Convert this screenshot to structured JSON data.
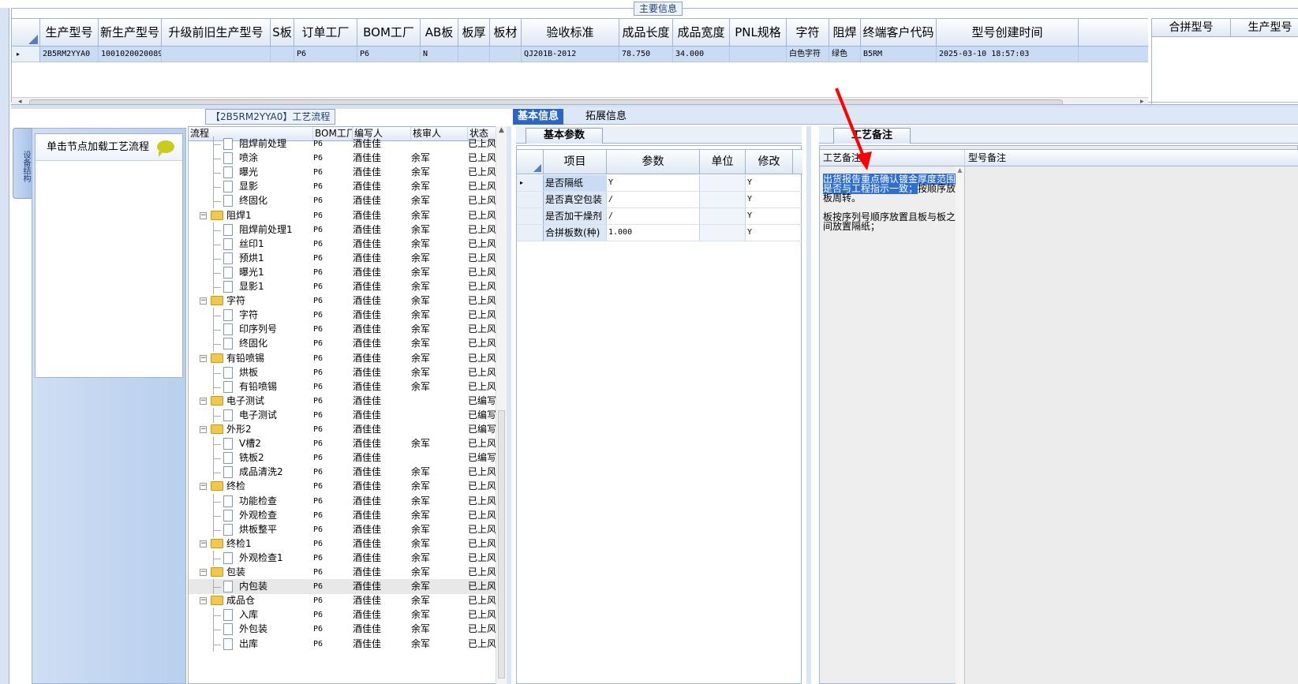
{
  "main_panel": {
    "title": "主要信息",
    "columns": [
      "生产型号",
      "新生产型号",
      "升级前旧生产型号",
      "S板",
      "订单工厂",
      "BOM工厂",
      "AB板",
      "板厚",
      "板材",
      "验收标准",
      "成品长度",
      "成品宽度",
      "PNL规格",
      "字符",
      "阻焊",
      "终端客户代码",
      "型号创建时间"
    ],
    "row": [
      "2B5RM2YYA0",
      "10010200200899",
      "",
      "",
      "P6",
      "P6",
      "N",
      "",
      "",
      "QJ201B-2012",
      "78.750",
      "34.000",
      "",
      "白色字符",
      "绿色",
      "B5RM",
      "2025-03-10 18:57:03"
    ],
    "row_marker": "▸",
    "merge_columns": [
      "合拼型号",
      "生产型号"
    ]
  },
  "sidebar": {
    "tab_label": "设备结构",
    "load_label": "单击节点加载工艺流程"
  },
  "flow": {
    "title": "【2B5RM2YYA0】工艺流程",
    "columns": [
      "流程",
      "BOM工厂",
      "编写人",
      "核审人",
      "状态"
    ],
    "rows": [
      {
        "label": "阻焊前处理",
        "level": 2,
        "folder": false,
        "bom": "P6",
        "writer": "酒佳佳",
        "reviewer": "",
        "status": "已上风"
      },
      {
        "label": "喷涂",
        "level": 2,
        "folder": false,
        "bom": "P6",
        "writer": "酒佳佳",
        "reviewer": "余军",
        "status": "已上风"
      },
      {
        "label": "曝光",
        "level": 2,
        "folder": false,
        "bom": "P6",
        "writer": "酒佳佳",
        "reviewer": "余军",
        "status": "已上风"
      },
      {
        "label": "显影",
        "level": 2,
        "folder": false,
        "bom": "P6",
        "writer": "酒佳佳",
        "reviewer": "余军",
        "status": "已上风"
      },
      {
        "label": "终固化",
        "level": 2,
        "folder": false,
        "bom": "P6",
        "writer": "酒佳佳",
        "reviewer": "余军",
        "status": "已上风"
      },
      {
        "label": "阻焊1",
        "level": 1,
        "folder": true,
        "bom": "P6",
        "writer": "酒佳佳",
        "reviewer": "余军",
        "status": "已上风"
      },
      {
        "label": "阻焊前处理1",
        "level": 2,
        "folder": false,
        "bom": "P6",
        "writer": "酒佳佳",
        "reviewer": "余军",
        "status": "已上风"
      },
      {
        "label": "丝印1",
        "level": 2,
        "folder": false,
        "bom": "P6",
        "writer": "酒佳佳",
        "reviewer": "余军",
        "status": "已上风"
      },
      {
        "label": "预烘1",
        "level": 2,
        "folder": false,
        "bom": "P6",
        "writer": "酒佳佳",
        "reviewer": "余军",
        "status": "已上风"
      },
      {
        "label": "曝光1",
        "level": 2,
        "folder": false,
        "bom": "P6",
        "writer": "酒佳佳",
        "reviewer": "余军",
        "status": "已上风"
      },
      {
        "label": "显影1",
        "level": 2,
        "folder": false,
        "bom": "P6",
        "writer": "酒佳佳",
        "reviewer": "余军",
        "status": "已上风"
      },
      {
        "label": "字符",
        "level": 1,
        "folder": true,
        "bom": "P6",
        "writer": "酒佳佳",
        "reviewer": "余军",
        "status": "已上风"
      },
      {
        "label": "字符",
        "level": 2,
        "folder": false,
        "bom": "P6",
        "writer": "酒佳佳",
        "reviewer": "余军",
        "status": "已上风"
      },
      {
        "label": "印序列号",
        "level": 2,
        "folder": false,
        "bom": "P6",
        "writer": "酒佳佳",
        "reviewer": "余军",
        "status": "已上风"
      },
      {
        "label": "终固化",
        "level": 2,
        "folder": false,
        "bom": "P6",
        "writer": "酒佳佳",
        "reviewer": "余军",
        "status": "已上风"
      },
      {
        "label": "有铅喷锡",
        "level": 1,
        "folder": true,
        "bom": "P6",
        "writer": "酒佳佳",
        "reviewer": "余军",
        "status": "已上风"
      },
      {
        "label": "烘板",
        "level": 2,
        "folder": false,
        "bom": "P6",
        "writer": "酒佳佳",
        "reviewer": "余军",
        "status": "已上风"
      },
      {
        "label": "有铅喷锡",
        "level": 2,
        "folder": false,
        "bom": "P6",
        "writer": "酒佳佳",
        "reviewer": "余军",
        "status": "已上风"
      },
      {
        "label": "电子测试",
        "level": 1,
        "folder": true,
        "bom": "P6",
        "writer": "酒佳佳",
        "reviewer": "",
        "status": "已编写"
      },
      {
        "label": "电子测试",
        "level": 2,
        "folder": false,
        "bom": "P6",
        "writer": "酒佳佳",
        "reviewer": "",
        "status": "已编写"
      },
      {
        "label": "外形2",
        "level": 1,
        "folder": true,
        "bom": "P6",
        "writer": "酒佳佳",
        "reviewer": "",
        "status": "已编写"
      },
      {
        "label": "V槽2",
        "level": 2,
        "folder": false,
        "bom": "P6",
        "writer": "酒佳佳",
        "reviewer": "余军",
        "status": "已上风"
      },
      {
        "label": "铣板2",
        "level": 2,
        "folder": false,
        "bom": "P6",
        "writer": "酒佳佳",
        "reviewer": "",
        "status": "已编写"
      },
      {
        "label": "成品清洗2",
        "level": 2,
        "folder": false,
        "bom": "P6",
        "writer": "酒佳佳",
        "reviewer": "余军",
        "status": "已上风"
      },
      {
        "label": "终检",
        "level": 1,
        "folder": true,
        "bom": "P6",
        "writer": "酒佳佳",
        "reviewer": "余军",
        "status": "已上风"
      },
      {
        "label": "功能检查",
        "level": 2,
        "folder": false,
        "bom": "P6",
        "writer": "酒佳佳",
        "reviewer": "余军",
        "status": "已上风"
      },
      {
        "label": "外观检查",
        "level": 2,
        "folder": false,
        "bom": "P6",
        "writer": "酒佳佳",
        "reviewer": "余军",
        "status": "已上风"
      },
      {
        "label": "烘板整平",
        "level": 2,
        "folder": false,
        "bom": "P6",
        "writer": "酒佳佳",
        "reviewer": "余军",
        "status": "已上风"
      },
      {
        "label": "终检1",
        "level": 1,
        "folder": true,
        "bom": "P6",
        "writer": "酒佳佳",
        "reviewer": "余军",
        "status": "已上风"
      },
      {
        "label": "外观检查1",
        "level": 2,
        "folder": false,
        "bom": "P6",
        "writer": "酒佳佳",
        "reviewer": "余军",
        "status": "已上风"
      },
      {
        "label": "包装",
        "level": 1,
        "folder": true,
        "bom": "P6",
        "writer": "酒佳佳",
        "reviewer": "余军",
        "status": "已上风"
      },
      {
        "label": "内包装",
        "level": 2,
        "folder": false,
        "bom": "P6",
        "writer": "酒佳佳",
        "reviewer": "余军",
        "status": "已上风",
        "selected": true
      },
      {
        "label": "成品仓",
        "level": 1,
        "folder": true,
        "bom": "P6",
        "writer": "酒佳佳",
        "reviewer": "余军",
        "status": "已上风"
      },
      {
        "label": "入库",
        "level": 2,
        "folder": false,
        "bom": "P6",
        "writer": "酒佳佳",
        "reviewer": "余军",
        "status": "已上风"
      },
      {
        "label": "外包装",
        "level": 2,
        "folder": false,
        "bom": "P6",
        "writer": "酒佳佳",
        "reviewer": "余军",
        "status": "已上风"
      },
      {
        "label": "出库",
        "level": 2,
        "folder": false,
        "bom": "P6",
        "writer": "酒佳佳",
        "reviewer": "余军",
        "status": "已上风"
      }
    ]
  },
  "tabs": [
    "基本信息",
    "拓展信息"
  ],
  "params": {
    "tab": "基本参数",
    "columns": [
      "项目",
      "参数",
      "单位",
      "修改"
    ],
    "rows": [
      {
        "item": "是否隔纸",
        "value": "Y",
        "unit": "",
        "modify": "Y"
      },
      {
        "item": "是否真空包装",
        "value": "/",
        "unit": "",
        "modify": "Y"
      },
      {
        "item": "是否加干燥剂",
        "value": "/",
        "unit": "",
        "modify": "Y"
      },
      {
        "item": "合拼板数(种)",
        "value": "1.000",
        "unit": "",
        "modify": "Y"
      }
    ]
  },
  "remarks": {
    "tab": "工艺备注",
    "col_process": "工艺备注",
    "col_model": "型号备注",
    "text_highlight": "出货报告重点确认镀金厚度范围是否与工程指示一致；",
    "text_rest": "按顺序放板周转。",
    "text_line2": "板按序列号顺序放置且板与板之间放置隔纸；"
  }
}
